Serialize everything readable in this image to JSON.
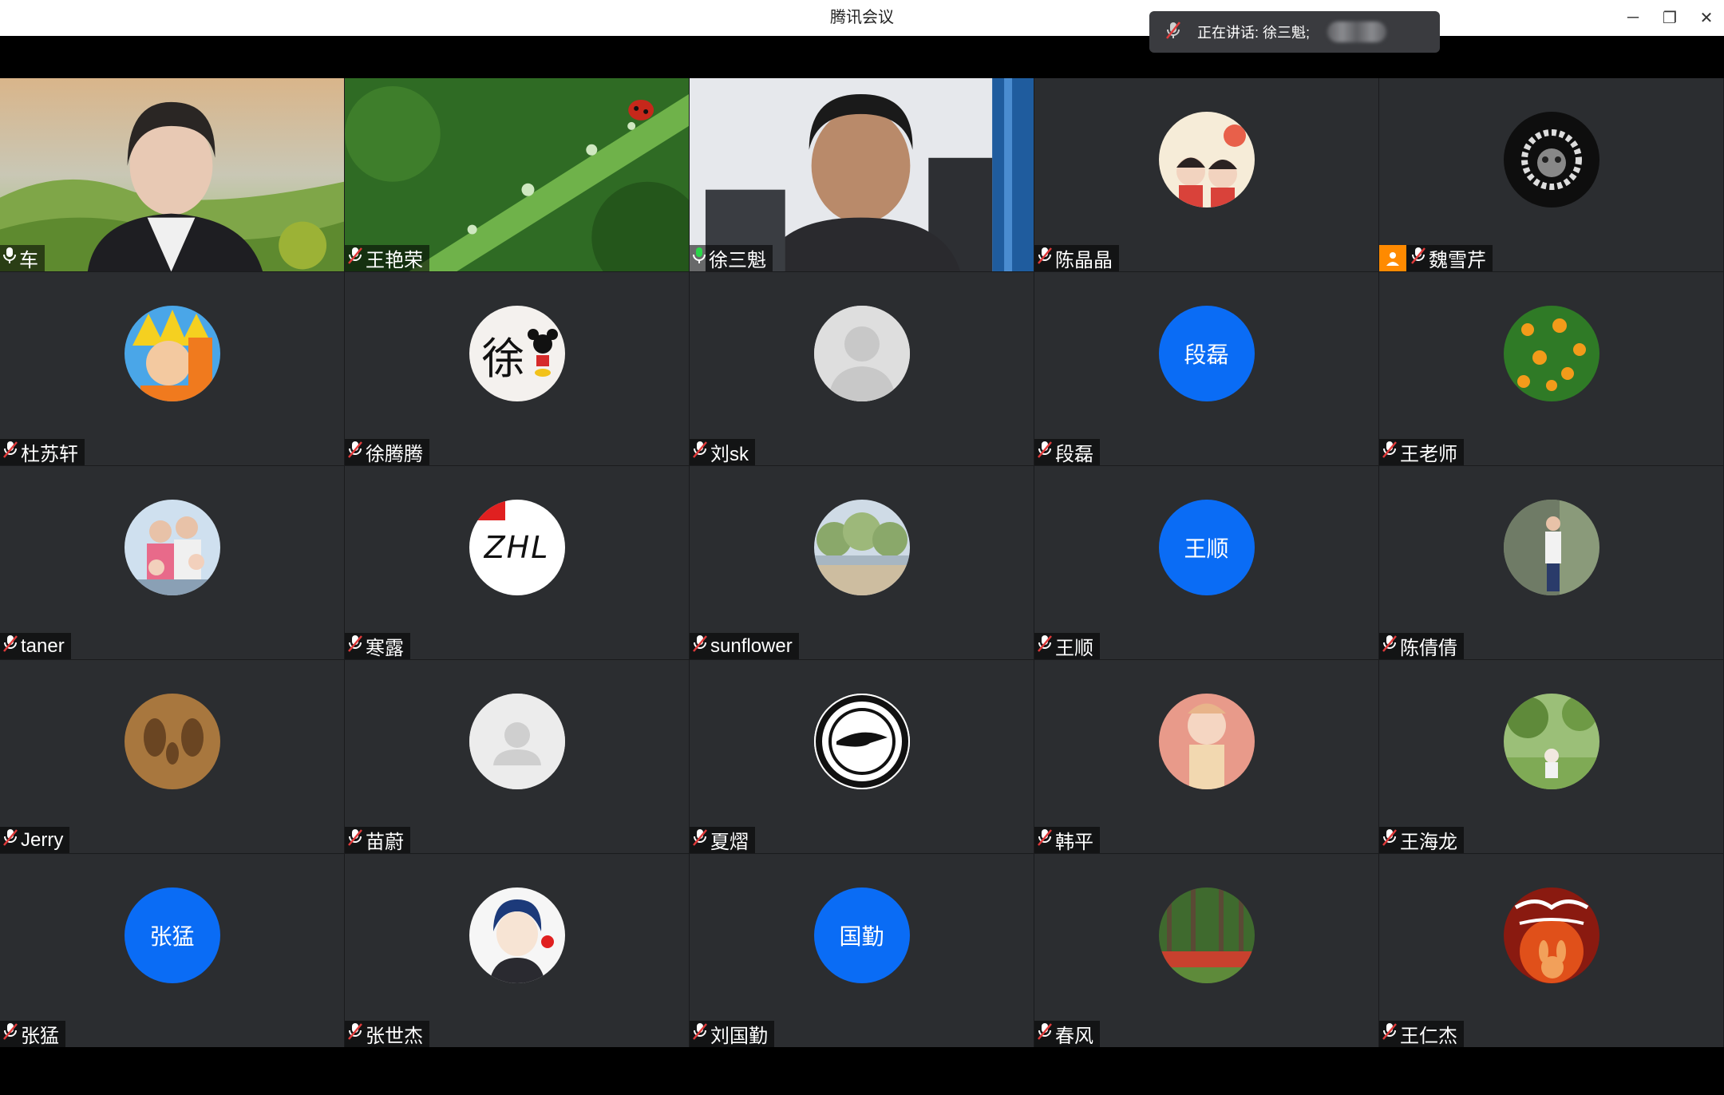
{
  "window": {
    "title": "腾讯会议",
    "minimize_icon": "─",
    "restore_icon": "❐",
    "close_icon": "✕"
  },
  "speaking": {
    "label": "正在讲话: 徐三魁;"
  },
  "participants": [
    {
      "name": "车",
      "mic": "on"
    },
    {
      "name": "王艳荣",
      "mic": "off"
    },
    {
      "name": "徐三魁",
      "mic": "on"
    },
    {
      "name": "陈晶晶",
      "mic": "off"
    },
    {
      "name": "魏雪芹",
      "mic": "off",
      "host": true
    },
    {
      "name": "杜苏轩",
      "mic": "off"
    },
    {
      "name": "徐腾腾",
      "mic": "off"
    },
    {
      "name": "刘sk",
      "mic": "off"
    },
    {
      "name": "段磊",
      "mic": "off",
      "avatar_text": "段磊"
    },
    {
      "name": "王老师",
      "mic": "off"
    },
    {
      "name": "taner",
      "mic": "off"
    },
    {
      "name": "寒露",
      "mic": "off"
    },
    {
      "name": "sunflower",
      "mic": "off"
    },
    {
      "name": "王顺",
      "mic": "off",
      "avatar_text": "王顺"
    },
    {
      "name": "陈倩倩",
      "mic": "off"
    },
    {
      "name": "Jerry",
      "mic": "off"
    },
    {
      "name": "苗蔚",
      "mic": "off"
    },
    {
      "name": "夏熠",
      "mic": "off"
    },
    {
      "name": "韩平",
      "mic": "off"
    },
    {
      "name": "王海龙",
      "mic": "off"
    },
    {
      "name": "张猛",
      "mic": "off",
      "avatar_text": "张猛"
    },
    {
      "name": "张世杰",
      "mic": "off"
    },
    {
      "name": "刘国勤",
      "mic": "off",
      "avatar_text": "国勤"
    },
    {
      "name": "春风",
      "mic": "off"
    },
    {
      "name": "王仁杰",
      "mic": "off"
    }
  ],
  "avatar_logo_text": "ZHL",
  "avatar_char_text": "徐"
}
